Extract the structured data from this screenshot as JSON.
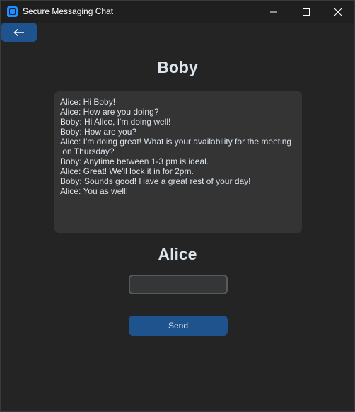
{
  "window": {
    "title": "Secure Messaging Chat",
    "icon": "app-icon"
  },
  "title_buttons": {
    "minimize_icon": "minimize-icon",
    "maximize_icon": "maximize-icon",
    "close_icon": "close-icon"
  },
  "back_button": {
    "icon": "arrow-left-icon"
  },
  "contact": {
    "name": "Boby"
  },
  "chat": {
    "lines": [
      "Alice: Hi Boby!",
      "Alice: How are you doing?",
      "Boby: Hi Alice, I'm doing well!",
      "Boby: How are you?",
      "Alice: I'm doing great! What is your availability for the meeting\n on Thursday?",
      "Boby: Anytime between 1-3 pm is ideal.",
      "Alice: Great! We'll lock it in for 2pm.",
      "Boby: Sounds good! Have a great rest of your day!",
      "Alice: You as well!"
    ]
  },
  "user": {
    "name": "Alice"
  },
  "composer": {
    "value": "",
    "send_label": "Send"
  },
  "colors": {
    "window_bg": "#242424",
    "titlebar_bg": "#1f1f1f",
    "accent": "#1f538d",
    "chat_bg": "#343434",
    "text": "#dce4ee",
    "input_border": "#565b5e"
  }
}
